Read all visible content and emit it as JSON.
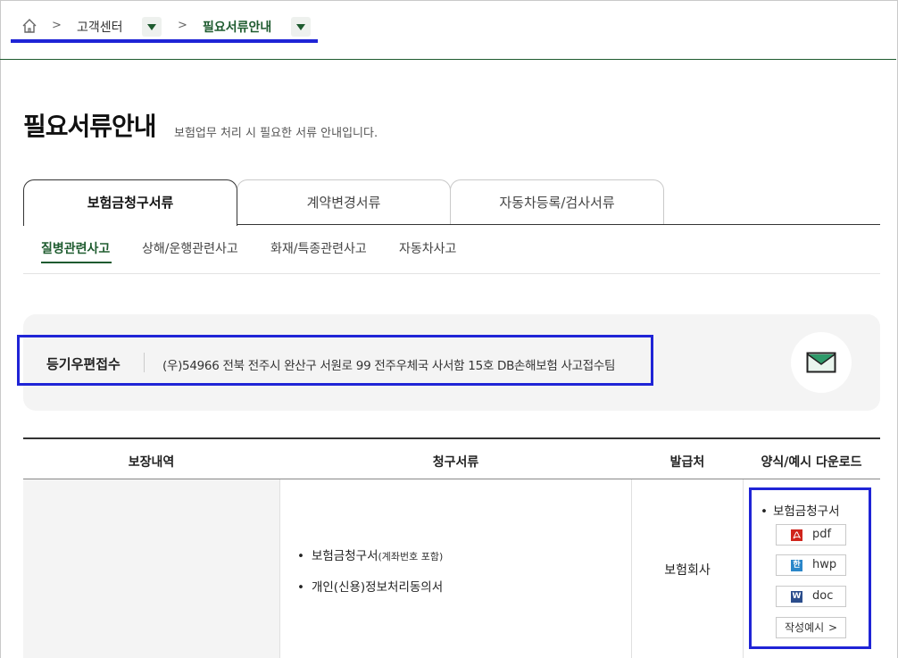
{
  "breadcrumb": {
    "items": [
      "고객센터",
      "필요서류안내"
    ],
    "separator": ">",
    "accent_color": "#1e5b2f"
  },
  "page": {
    "title": "필요서류안내",
    "description": "보험업무 처리 시 필요한 서류 안내입니다."
  },
  "tabs": [
    {
      "label": "보험금청구서류",
      "active": true
    },
    {
      "label": "계약변경서류",
      "active": false
    },
    {
      "label": "자동차등록/검사서류",
      "active": false
    }
  ],
  "subtabs": [
    {
      "label": "질병관련사고",
      "active": true
    },
    {
      "label": "상해/운행관련사고",
      "active": false
    },
    {
      "label": "화재/특종관련사고",
      "active": false
    },
    {
      "label": "자동차사고",
      "active": false
    }
  ],
  "mail": {
    "label": "등기우편접수",
    "address": "(우)54966 전북 전주시 완산구 서원로 99 전주우체국 사서함 15호 DB손해보험 사고접수팀"
  },
  "table": {
    "headers": [
      "보장내역",
      "청구서류",
      "발급처",
      "양식/예시 다운로드"
    ],
    "row": {
      "coverage": "",
      "documents": [
        {
          "text": "보험금청구서",
          "note": "(계좌번호 포함)"
        },
        {
          "text": "개인(신용)정보처리동의서",
          "note": ""
        }
      ],
      "issuer": "보험회사",
      "download": {
        "title": "보험금청구서",
        "buttons": [
          {
            "label": "pdf",
            "icon": "pdf-icon"
          },
          {
            "label": "hwp",
            "icon": "hwp-icon"
          },
          {
            "label": "doc",
            "icon": "word-icon"
          }
        ],
        "example_label": "작성예시",
        "example_chevron": ">"
      }
    }
  },
  "colors": {
    "highlight": "#1f24d6",
    "brand": "#1e5b2f",
    "mail_icon": "#2e9a6a"
  }
}
